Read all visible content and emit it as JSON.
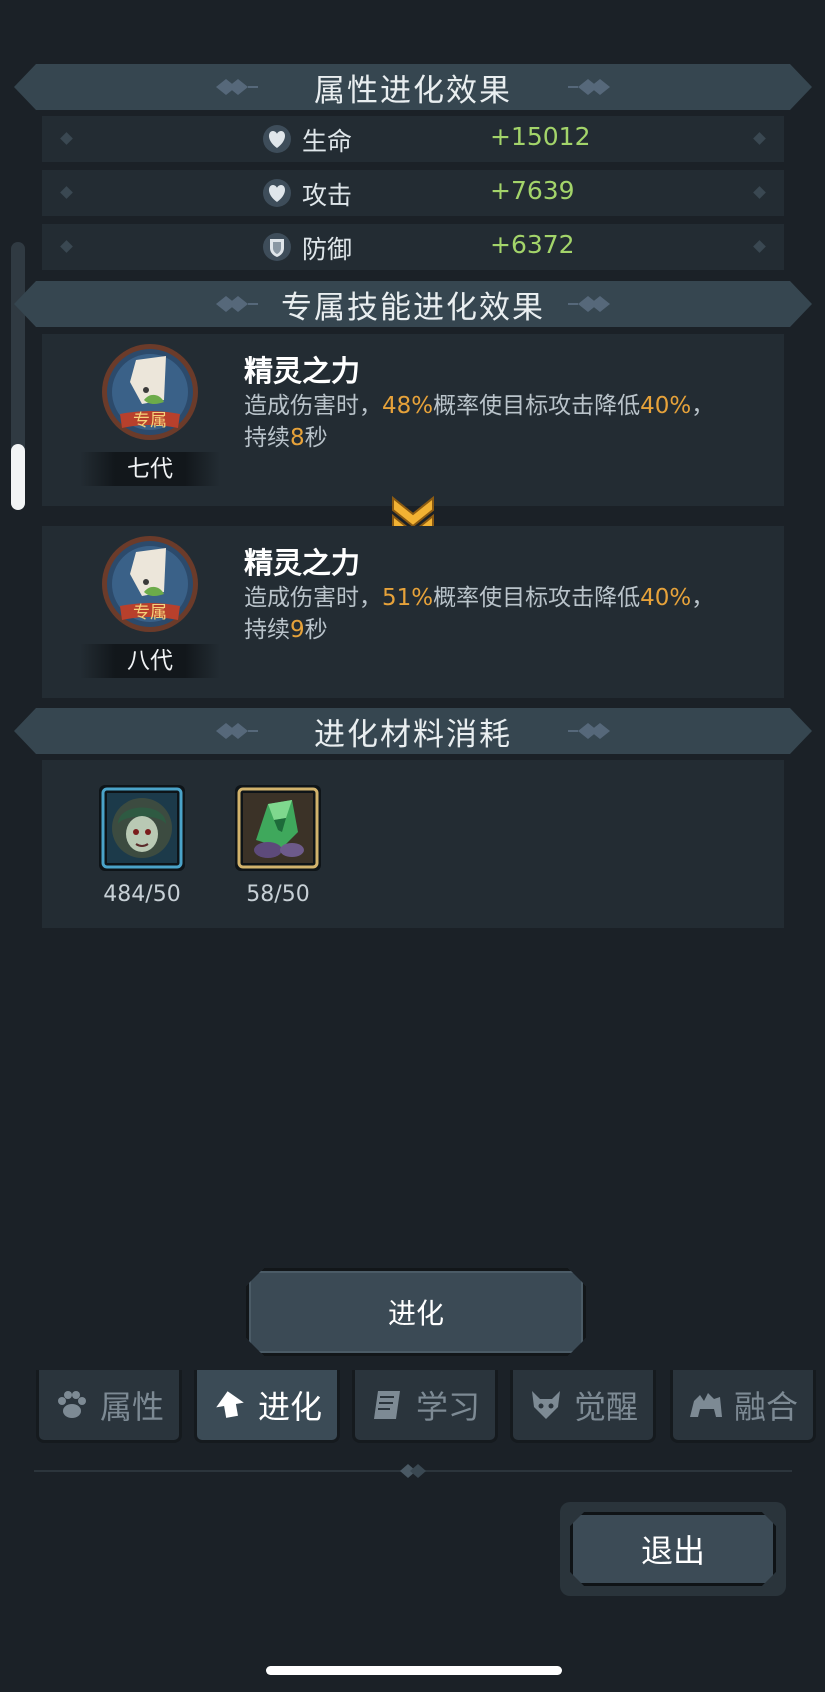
{
  "sections": {
    "attr_title": "属性进化效果",
    "skill_title": "专属技能进化效果",
    "material_title": "进化材料消耗"
  },
  "stats": [
    {
      "icon": "heart-shield-icon",
      "name": "生命",
      "value": "+15012"
    },
    {
      "icon": "heart-shield-icon",
      "name": "攻击",
      "value": "+7639"
    },
    {
      "icon": "armor-shield-icon",
      "name": "防御",
      "value": "+6372"
    }
  ],
  "skills": {
    "current": {
      "badge_text": "专属",
      "generation": "七代",
      "name": "精灵之力",
      "desc_1": "造成伤害时，",
      "chance": "48%",
      "desc_2": "概率使目标攻击降低",
      "reduce": "40%",
      "desc_3": "，",
      "desc_4": "持续",
      "duration": "8",
      "desc_5": "秒"
    },
    "next": {
      "badge_text": "专属",
      "generation": "八代",
      "name": "精灵之力",
      "desc_1": "造成伤害时，",
      "chance": "51%",
      "desc_2": "概率使目标攻击降低",
      "reduce": "40%",
      "desc_3": "，",
      "desc_4": "持续",
      "duration": "9",
      "desc_5": "秒"
    }
  },
  "materials": [
    {
      "icon": "hero-portrait-icon",
      "count": "484/50",
      "frame_color": "#4aa3c9"
    },
    {
      "icon": "green-crystal-icon",
      "count": "58/50",
      "frame_color": "#d2b36c"
    }
  ],
  "evolve_button": "进化",
  "tabs": [
    {
      "label": "属性",
      "icon": "paw-icon",
      "active": false
    },
    {
      "label": "进化",
      "icon": "up-arrow-icon",
      "active": true
    },
    {
      "label": "学习",
      "icon": "book-icon",
      "active": false
    },
    {
      "label": "觉醒",
      "icon": "demon-head-icon",
      "active": false
    },
    {
      "label": "融合",
      "icon": "beast-icon",
      "active": false
    }
  ],
  "exit_button": "退出",
  "colors": {
    "stat_value": "#a3d46a",
    "highlight": "#e6a23a",
    "panel": "#232c33",
    "header": "#364650"
  }
}
